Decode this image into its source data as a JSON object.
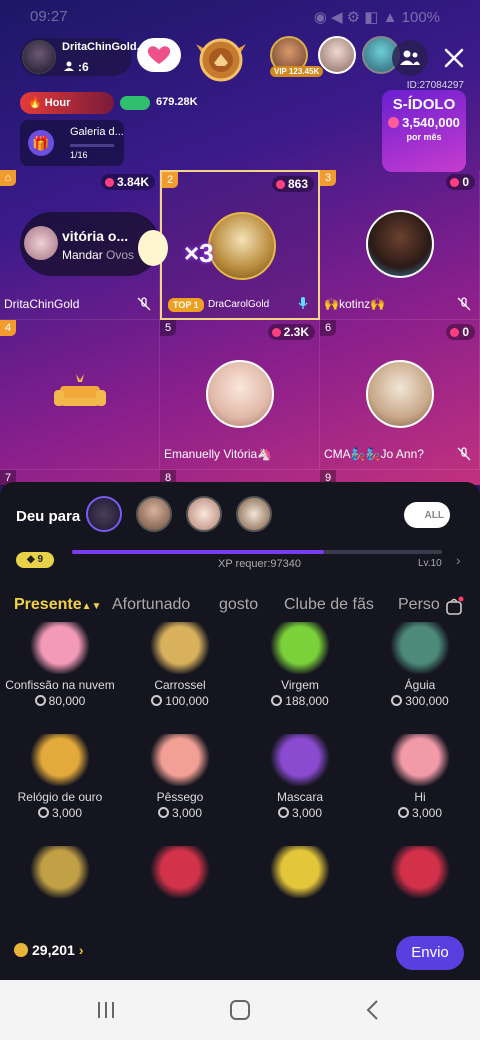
{
  "status_bar": {
    "time": "09:27",
    "right": "◉ ◀ ⚙ ◧ ▲ 100%"
  },
  "host": {
    "name": "DritaChinGold...",
    "viewers": ":6"
  },
  "top_viewers": {
    "vip_label": "VIP",
    "vip_score": "123.45K"
  },
  "room_id": "ID:27084297",
  "hour_label": "Hour",
  "energy_value": "679.28K",
  "gallery": {
    "title": "Galeria d...",
    "progress": "1/16"
  },
  "idolo": {
    "title": "S-ÍDOLO",
    "value": "3,540,000",
    "period": "por mês"
  },
  "seats": [
    {
      "num": "",
      "score": "3.84K",
      "name": "DritaChinGold",
      "overlay_name": "vitória o...",
      "overlay_action": "Mandar",
      "overlay_gift": "Ovos"
    },
    {
      "num": "2",
      "score": "863",
      "name": "DraCarolGold",
      "top_label": "TOP 1",
      "combo": "×3"
    },
    {
      "num": "3",
      "score": "0",
      "name": "🙌kotinz🙌"
    },
    {
      "num": "4",
      "score": "",
      "name": ""
    },
    {
      "num": "5",
      "score": "2.3K",
      "name": "Emanuelly Vitória🦄"
    },
    {
      "num": "6",
      "score": "0",
      "name": "CMA🧞🧞Jo Ann?"
    }
  ],
  "partial_seats": [
    "7",
    "8",
    "9"
  ],
  "panel": {
    "deu_para": "Deu para",
    "all_toggle": "ALL",
    "level_badge": "9",
    "xp_progress": 0.68,
    "xp_text": "XP requer:97340",
    "xp_level": "Lv.10"
  },
  "tabs": [
    "Presente",
    "Afortunado",
    "gosto",
    "Clube de fãs",
    "Perso"
  ],
  "gifts": [
    {
      "name": "Confissão na nuvem",
      "price": "80,000",
      "icon": "parachute-icon",
      "color": "#f49ab9"
    },
    {
      "name": "Carrossel",
      "price": "100,000",
      "icon": "carousel-icon",
      "color": "#d9b15c"
    },
    {
      "name": "Virgem",
      "price": "188,000",
      "icon": "virgo-icon",
      "color": "#7ad13a"
    },
    {
      "name": "Águia",
      "price": "300,000",
      "icon": "eagle-icon",
      "color": "#4d8a7a"
    },
    {
      "name": "Relógio de ouro",
      "price": "3,000",
      "icon": "gold-watch-icon",
      "color": "#e3a93a"
    },
    {
      "name": "Pêssego",
      "price": "3,000",
      "icon": "peach-icon",
      "color": "#f2a095"
    },
    {
      "name": "Mascara",
      "price": "3,000",
      "icon": "mask-icon",
      "color": "#8a4bd0"
    },
    {
      "name": "Hi",
      "price": "3,000",
      "icon": "paw-icon",
      "color": "#f29aa8"
    },
    {
      "name": "",
      "price": "",
      "icon": "gold-trophy-icon",
      "color": "#c2a046"
    },
    {
      "name": "",
      "price": "",
      "icon": "lipstick-icon",
      "color": "#d3334a"
    },
    {
      "name": "",
      "price": "",
      "icon": "party-icon",
      "color": "#e4c63a"
    },
    {
      "name": "",
      "price": "",
      "icon": "hot-air-balloon-icon",
      "color": "#d3304a"
    }
  ],
  "balance": "29,201",
  "send_label": "Envio"
}
